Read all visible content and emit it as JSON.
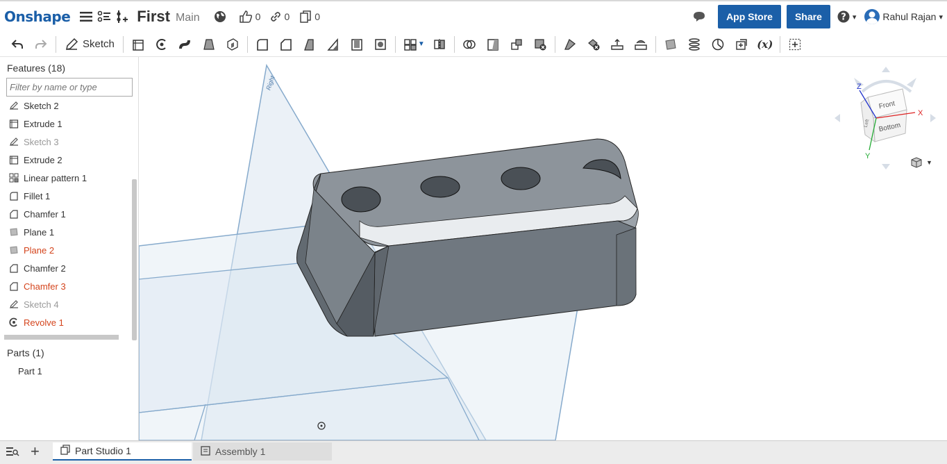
{
  "app": {
    "logo": "Onshape",
    "document_title": "First",
    "branch": "Main",
    "likes": "0",
    "links": "0",
    "copies": "0"
  },
  "header": {
    "app_store_label": "App Store",
    "share_label": "Share",
    "help_caret": "▾",
    "user_name": "Rahul Rajan",
    "user_caret": "▾"
  },
  "toolbar": {
    "sketch_label": "Sketch",
    "variable_label": "(x)"
  },
  "features": {
    "header": "Features (18)",
    "filter_placeholder": "Filter by name or type",
    "items": [
      {
        "label": "Sketch 2",
        "icon": "sketch-icon",
        "state": "normal"
      },
      {
        "label": "Extrude 1",
        "icon": "extrude-icon",
        "state": "normal"
      },
      {
        "label": "Sketch 3",
        "icon": "sketch-icon",
        "state": "dim"
      },
      {
        "label": "Extrude 2",
        "icon": "extrude-icon",
        "state": "normal"
      },
      {
        "label": "Linear pattern 1",
        "icon": "pattern-icon",
        "state": "normal"
      },
      {
        "label": "Fillet 1",
        "icon": "fillet-icon",
        "state": "normal"
      },
      {
        "label": "Chamfer 1",
        "icon": "chamfer-icon",
        "state": "normal"
      },
      {
        "label": "Plane 1",
        "icon": "plane-icon",
        "state": "normal"
      },
      {
        "label": "Plane 2",
        "icon": "plane-icon",
        "state": "error"
      },
      {
        "label": "Chamfer 2",
        "icon": "chamfer-icon",
        "state": "normal"
      },
      {
        "label": "Chamfer 3",
        "icon": "chamfer-icon",
        "state": "error"
      },
      {
        "label": "Sketch 4",
        "icon": "sketch-icon",
        "state": "dim"
      },
      {
        "label": "Revolve 1",
        "icon": "revolve-icon",
        "state": "error"
      }
    ]
  },
  "parts": {
    "header": "Parts (1)",
    "items": [
      "Part 1"
    ]
  },
  "viewcube": {
    "front": "Front",
    "bottom": "Bottom",
    "left": "Left",
    "x": "X",
    "y": "Y",
    "z": "Z"
  },
  "viewport": {
    "plane_label": "Right"
  },
  "tabs": [
    {
      "label": "Part Studio 1",
      "active": true
    },
    {
      "label": "Assembly 1",
      "active": false
    }
  ],
  "colors": {
    "brand": "#1b5fa8",
    "error": "#d4441c",
    "plane": "#7aa3cc",
    "part": "#7d858e"
  }
}
